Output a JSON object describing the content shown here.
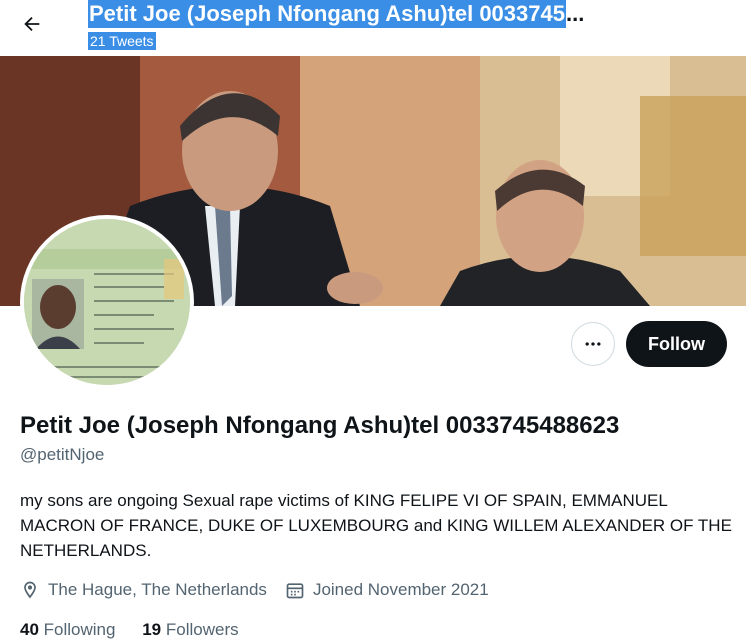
{
  "header": {
    "display_name": "Petit Joe (Joseph Nfongang Ashu)tel 0033745",
    "ellipsis": "...",
    "tweet_count": "21 Tweets"
  },
  "profile": {
    "name": "Petit Joe (Joseph Nfongang Ashu)tel 0033745488623",
    "handle": "@petitNjoe",
    "bio": "my sons are ongoing Sexual rape victims of KING FELIPE VI OF SPAIN, EMMANUEL MACRON OF FRANCE, DUKE OF LUXEMBOURG and KING WILLEM ALEXANDER OF THE NETHERLANDS.",
    "location": "The Hague, The Netherlands",
    "joined": "Joined November 2021"
  },
  "stats": {
    "following_count": "40",
    "following_label": "Following",
    "followers_count": "19",
    "followers_label": "Followers"
  },
  "buttons": {
    "follow": "Follow"
  },
  "icons": {
    "back": "arrow-left-icon",
    "more": "more-horizontal-icon",
    "location": "location-pin-icon",
    "calendar": "calendar-icon"
  }
}
